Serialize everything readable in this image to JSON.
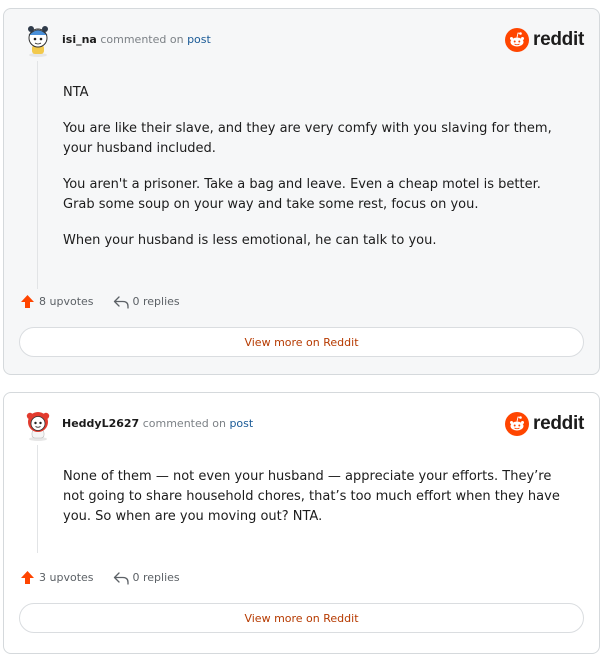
{
  "brand": {
    "wordmark": "reddit",
    "accent": "#ff4500",
    "link_color": "#1a5a96",
    "button_text_color": "#b63a00"
  },
  "comments": [
    {
      "username": "isi_na",
      "action_text": "commented on",
      "post_link": "post",
      "paragraphs": [
        "NTA",
        "You are like their slave, and they are very comfy with you slaving for them, your husband included.",
        "You aren't a prisoner. Take a bag and leave. Even a cheap motel is better. Grab some soup on your way and take some rest, focus on you.",
        "When your husband is less emotional, he can talk to you."
      ],
      "upvotes": "8 upvotes",
      "replies": "0 replies",
      "view_more": "View more on Reddit"
    },
    {
      "username": "HeddyL2627",
      "action_text": "commented on",
      "post_link": "post",
      "paragraphs": [
        "None of them — not even your husband — appreciate your efforts. They’re not going to share household chores, that’s too much effort when they have you. So when are you moving out? NTA."
      ],
      "upvotes": "3 upvotes",
      "replies": "0 replies",
      "view_more": "View more on Reddit"
    }
  ]
}
